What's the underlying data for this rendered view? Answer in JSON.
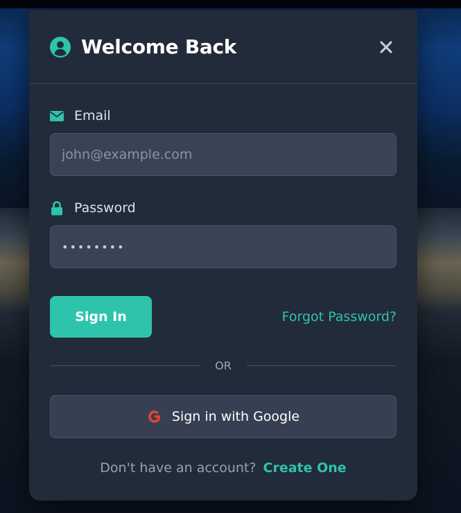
{
  "modal": {
    "title": "Welcome Back",
    "close_label": "×"
  },
  "form": {
    "email_label": "Email",
    "email_placeholder": "john@example.com",
    "password_label": "Password",
    "password_value": "••••••••",
    "signin_label": "Sign In",
    "forgot_label": "Forgot Password?",
    "divider_text": "OR",
    "google_label": "Sign in with Google"
  },
  "footer": {
    "prompt": "Don't have an account?",
    "create_label": "Create One"
  },
  "colors": {
    "accent": "#2ec4ac",
    "modal_bg": "#222b3a",
    "input_bg": "#3a4355",
    "google_red": "#ea4335"
  },
  "icons": {
    "title_icon": "user-circle-icon",
    "email_icon": "envelope-icon",
    "password_icon": "lock-icon",
    "google_icon": "google-icon",
    "close_icon": "close-icon"
  }
}
